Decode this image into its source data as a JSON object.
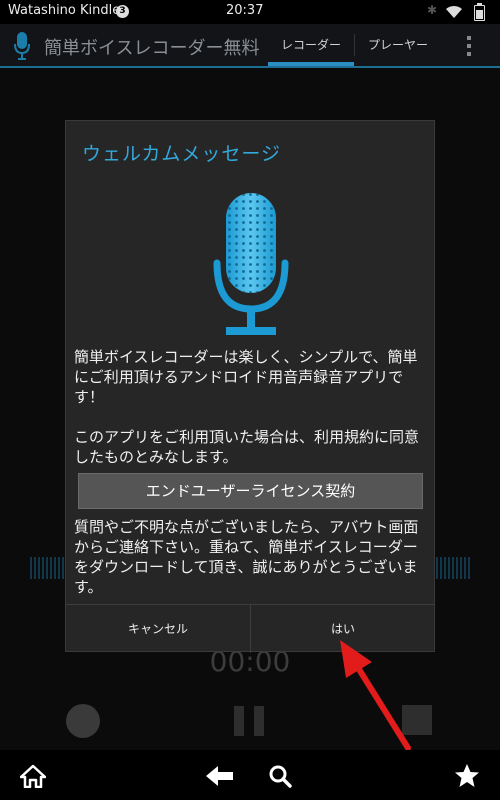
{
  "status_bar": {
    "device_name": "Watashino Kindle",
    "notification_count": "3",
    "time": "20:37"
  },
  "action_bar": {
    "app_title": "簡単ボイスレコーダー無料版",
    "tabs": [
      {
        "label": "レコーダー",
        "selected": true
      },
      {
        "label": "プレーヤー",
        "selected": false
      }
    ]
  },
  "background": {
    "timer": "00:00"
  },
  "dialog": {
    "title": "ウェルカムメッセージ",
    "paragraph1": "簡単ボイスレコーダーは楽しく、シンプルで、簡単にご利用頂けるアンドロイド用音声録音アプリです！",
    "paragraph2": "このアプリをご利用頂いた場合は、利用規約に同意したものとみなします。",
    "license_button": "エンドユーザーライセンス契約",
    "paragraph3": "質問やご不明な点がございましたら、アバウト画面からご連絡下さい。重ねて、簡単ボイスレコーダーをダウンロードして頂き、誠にありがとうございます。",
    "cancel_button": "キャンセル",
    "ok_button": "はい"
  },
  "colors": {
    "accent": "#33a8db",
    "annotation_arrow": "#e21b1b"
  },
  "icons": {
    "nav": [
      "home-icon",
      "back-icon",
      "search-icon",
      "favorite-star-icon"
    ]
  }
}
